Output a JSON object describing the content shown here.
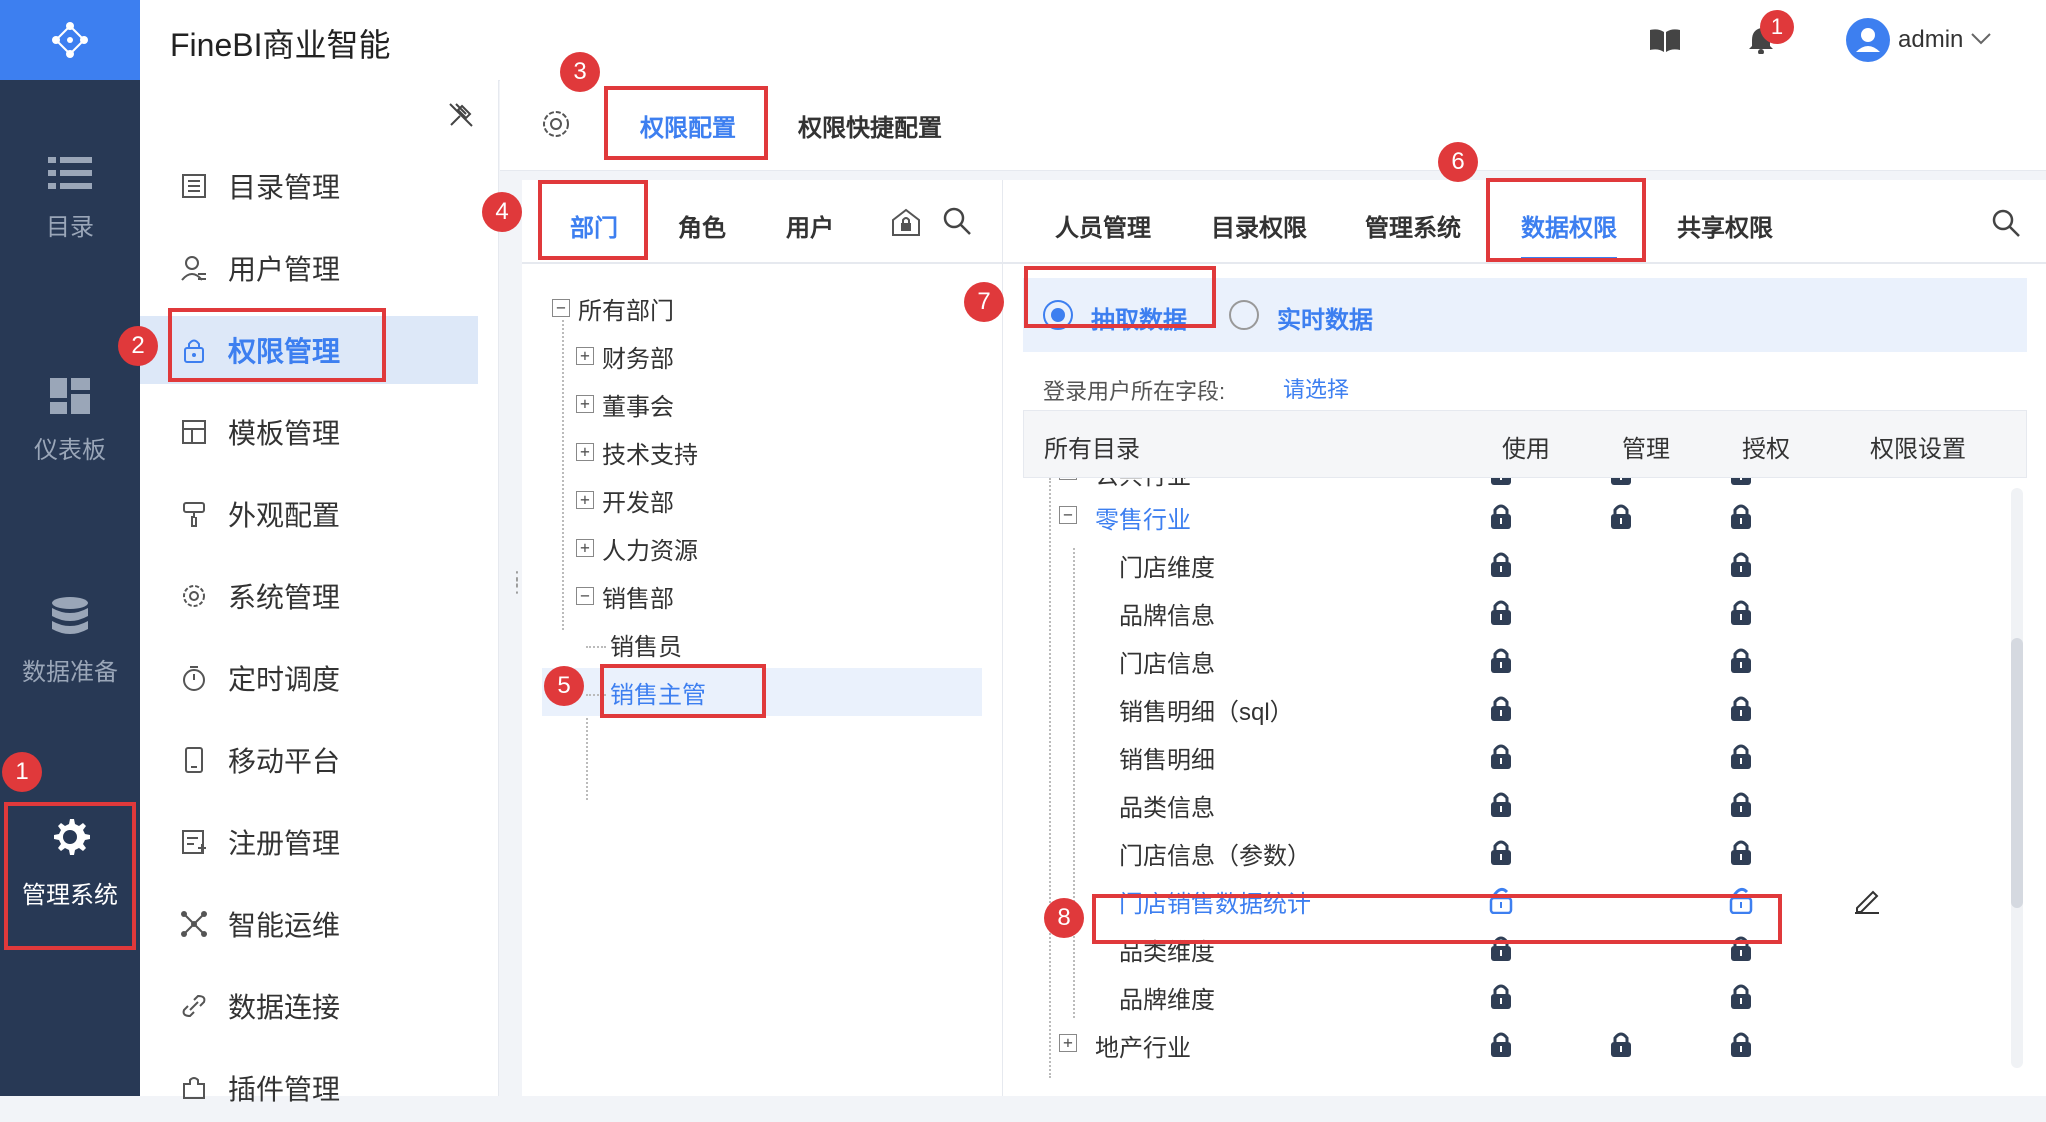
{
  "header": {
    "app_title": "FineBI商业智能",
    "notification_count": "1",
    "username": "admin"
  },
  "rail": {
    "items": [
      {
        "label": "目录"
      },
      {
        "label": "仪表板"
      },
      {
        "label": "数据准备"
      },
      {
        "label": "管理系统"
      }
    ]
  },
  "sidebar": {
    "items": [
      {
        "label": "目录管理"
      },
      {
        "label": "用户管理"
      },
      {
        "label": "权限管理"
      },
      {
        "label": "模板管理"
      },
      {
        "label": "外观配置"
      },
      {
        "label": "系统管理"
      },
      {
        "label": "定时调度"
      },
      {
        "label": "移动平台"
      },
      {
        "label": "注册管理"
      },
      {
        "label": "智能运维"
      },
      {
        "label": "数据连接"
      },
      {
        "label": "插件管理"
      }
    ]
  },
  "top_tabs": [
    {
      "label": "权限配置"
    },
    {
      "label": "权限快捷配置"
    }
  ],
  "left_tabs": [
    {
      "label": "部门"
    },
    {
      "label": "角色"
    },
    {
      "label": "用户"
    }
  ],
  "dept_tree": [
    {
      "label": "所有部门"
    },
    {
      "label": "财务部"
    },
    {
      "label": "董事会"
    },
    {
      "label": "技术支持"
    },
    {
      "label": "开发部"
    },
    {
      "label": "人力资源"
    },
    {
      "label": "销售部"
    },
    {
      "label": "销售员"
    },
    {
      "label": "销售主管"
    }
  ],
  "right_tabs": [
    {
      "label": "人员管理"
    },
    {
      "label": "目录权限"
    },
    {
      "label": "管理系统"
    },
    {
      "label": "数据权限"
    },
    {
      "label": "共享权限"
    }
  ],
  "data_mode": {
    "extract": "抽取数据",
    "realtime": "实时数据"
  },
  "login_field": {
    "label": "登录用户所在字段:",
    "value": "请选择"
  },
  "table": {
    "headers": [
      "所有目录",
      "使用",
      "管理",
      "授权",
      "权限设置"
    ],
    "rows": [
      {
        "name": "公共行业"
      },
      {
        "name": "零售行业"
      },
      {
        "name": "门店维度"
      },
      {
        "name": "品牌信息"
      },
      {
        "name": "门店信息"
      },
      {
        "name": "销售明细（sql）"
      },
      {
        "name": "销售明细"
      },
      {
        "name": "品类信息"
      },
      {
        "name": "门店信息（参数）"
      },
      {
        "name": "门店销售数据统计"
      },
      {
        "name": "品类维度"
      },
      {
        "name": "品牌维度"
      },
      {
        "name": "地产行业"
      }
    ]
  },
  "badges": [
    "1",
    "2",
    "3",
    "4",
    "5",
    "6",
    "7",
    "8"
  ],
  "colors": {
    "accent": "#3d7ff0",
    "rail": "#283955",
    "highlight": "#e0393b"
  }
}
